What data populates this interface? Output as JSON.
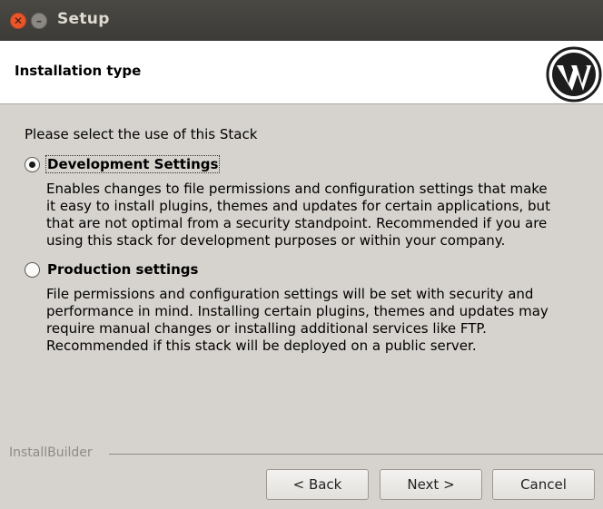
{
  "window": {
    "title": "Setup"
  },
  "header": {
    "title": "Installation type"
  },
  "main": {
    "prompt": "Please select the use of this Stack",
    "options": [
      {
        "label": "Development Settings",
        "selected": true,
        "description_lines": [
          "Enables changes to file permissions and configuration settings that make",
          "it easy to install plugins, themes and updates for certain applications, but",
          "that are not optimal from a security standpoint. Recommended if you are",
          "using this stack for development purposes or within your company."
        ]
      },
      {
        "label": "Production settings",
        "selected": false,
        "description_lines": [
          "File permissions and configuration settings will be set with security and",
          "performance in mind. Installing certain plugins, themes and updates may",
          "require manual changes or installing additional services like FTP.",
          "Recommended if this stack will be deployed on a public server."
        ]
      }
    ]
  },
  "footer": {
    "brand": "InstallBuilder",
    "back_label": "< Back",
    "next_label": "Next >",
    "cancel_label": "Cancel"
  },
  "icons": {
    "close": "close-icon",
    "minimize": "minimize-icon",
    "logo": "wordpress-logo"
  }
}
